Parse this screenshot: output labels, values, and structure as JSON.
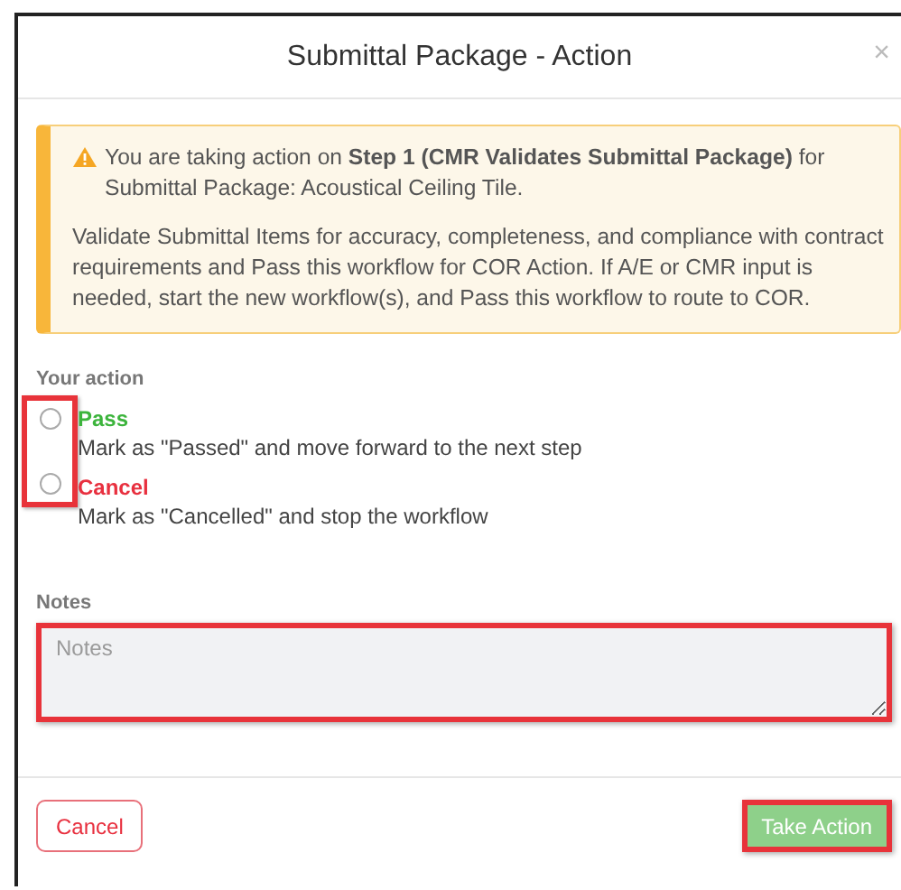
{
  "dialog": {
    "title": "Submittal Package - Action",
    "close": "×"
  },
  "alert": {
    "lead": "You are taking action on **Step 1 (CMR Validates Submittal Package)** for Submittal Package: Acoustical Ceiling Tile.",
    "body": "Validate Submittal Items for accuracy, completeness, and compliance with contract requirements and Pass this workflow for COR Action. If A/E or CMR input is needed, start the new workflow(s), and Pass this workflow to route to COR."
  },
  "action": {
    "label": "Your action",
    "highlighted": true,
    "options": [
      {
        "label": "Pass",
        "description": "Mark as \"Passed\" and move forward to the next step",
        "selected": false,
        "color": "#3cb43c"
      },
      {
        "label": "Cancel",
        "description": "Mark as \"Cancelled\" and stop the workflow",
        "selected": false,
        "color": "#e8303f"
      }
    ]
  },
  "notes": {
    "label": "Notes",
    "placeholder": "Notes",
    "highlighted": true
  },
  "buttons": [
    {
      "label": "Cancel",
      "kind": "outline",
      "highlighted": false
    },
    {
      "label": "Take Action",
      "kind": "primary",
      "highlighted": true
    }
  ]
}
